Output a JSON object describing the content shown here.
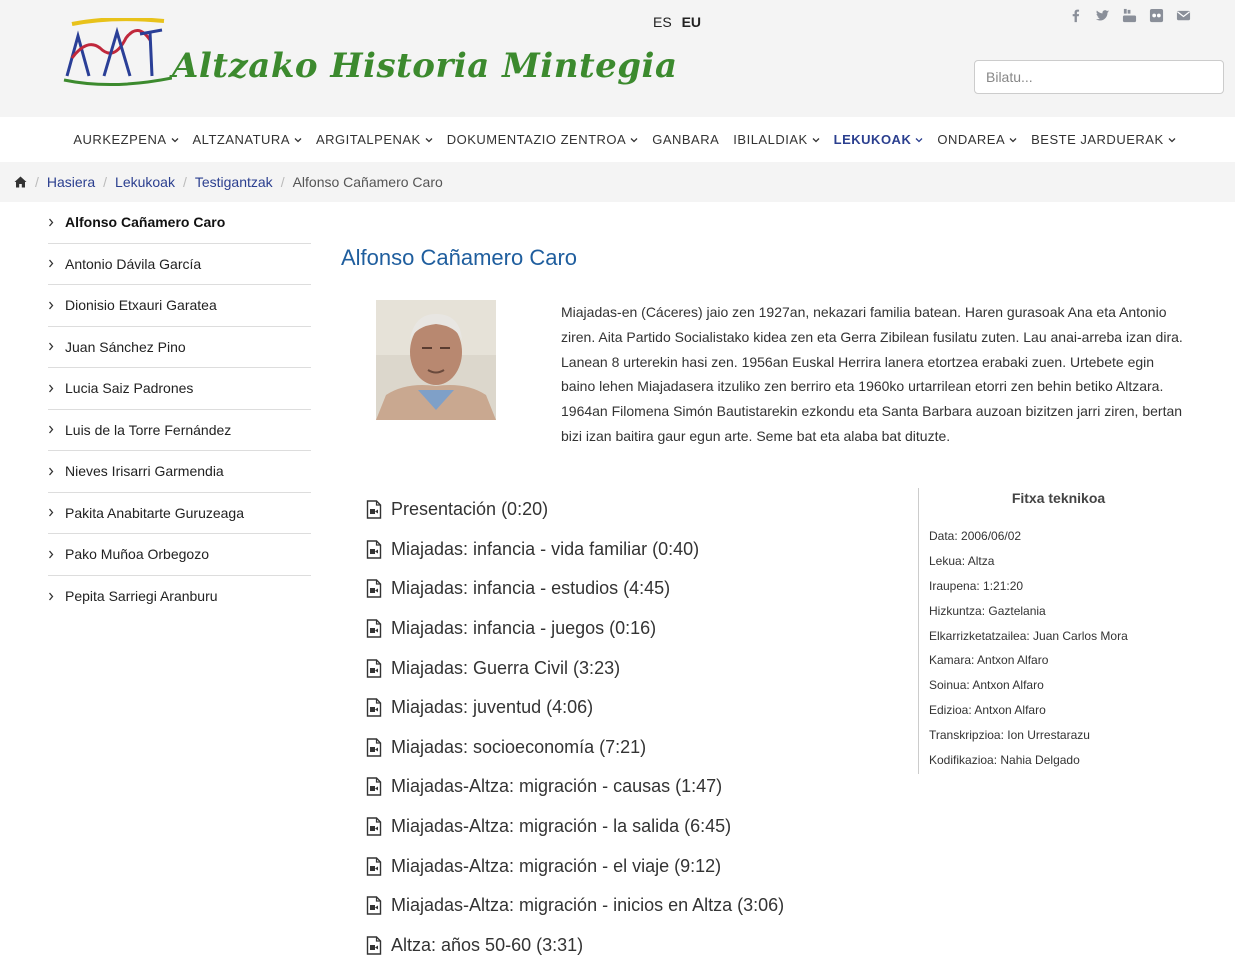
{
  "header": {
    "site_title": "Altzako Historia Mintegia",
    "languages": [
      "ES",
      "EU"
    ],
    "active_language": "EU",
    "social_icons": [
      "facebook-icon",
      "twitter-icon",
      "youtube-icon",
      "flickr-icon",
      "email-icon"
    ],
    "search_placeholder": "Bilatu..."
  },
  "nav": {
    "items": [
      {
        "label": "AURKEZPENA",
        "dropdown": true
      },
      {
        "label": "ALTZANATURA",
        "dropdown": true
      },
      {
        "label": "ARGITALPENAK",
        "dropdown": true
      },
      {
        "label": "DOKUMENTAZIO ZENTROA",
        "dropdown": true
      },
      {
        "label": "GANBARA",
        "dropdown": false
      },
      {
        "label": "IBILALDIAK",
        "dropdown": true
      },
      {
        "label": "LEKUKOAK",
        "dropdown": true,
        "active": true
      },
      {
        "label": "ONDAREA",
        "dropdown": true
      },
      {
        "label": "BESTE JARDUERAK",
        "dropdown": true
      }
    ]
  },
  "breadcrumb": {
    "items": [
      "Hasiera",
      "Lekukoak",
      "Testigantzak"
    ],
    "current": "Alfonso Cañamero Caro"
  },
  "sidebar": {
    "items": [
      "Alfonso Cañamero Caro",
      "Antonio Dávila García",
      "Dionisio Etxauri Garatea",
      "Juan Sánchez Pino",
      "Lucia Saiz Padrones",
      "Luis de la Torre Fernández",
      "Nieves Irisarri Garmendia",
      "Pakita Anabitarte Guruzeaga",
      "Pako Muñoa Orbegozo",
      "Pepita Sarriegi Aranburu"
    ],
    "active_index": 0
  },
  "main": {
    "title": "Alfonso Cañamero Caro",
    "bio": "Miajadas-en (Cáceres) jaio zen 1927an, nekazari familia batean. Haren gurasoak Ana eta Antonio ziren. Aita Partido Socialistako kidea zen eta Gerra Zibilean fusilatu zuten. Lau anai-arreba izan dira. Lanean 8 urterekin hasi zen. 1956an Euskal Herrira lanera etortzea erabaki zuen. Urtebete egin baino lehen Miajadasera itzuliko zen berriro eta 1960ko urtarrilean etorri zen behin betiko Altzara. 1964an Filomena Simón Bautistarekin ezkondu eta Santa Barbara auzoan bizitzen jarri ziren, bertan bizi izan baitira gaur egun arte. Seme bat eta alaba bat dituzte.",
    "videos": [
      "Presentación (0:20)",
      "Miajadas: infancia - vida familiar (0:40)",
      "Miajadas: infancia - estudios (4:45)",
      "Miajadas: infancia - juegos (0:16)",
      "Miajadas: Guerra Civil (3:23)",
      "Miajadas: juventud (4:06)",
      "Miajadas: socioeconomía (7:21)",
      "Miajadas-Altza: migración - causas (1:47)",
      "Miajadas-Altza: migración - la salida (6:45)",
      "Miajadas-Altza: migración - el viaje (9:12)",
      "Miajadas-Altza: migración - inicios en Altza (3:06)",
      "Altza: años 50-60 (3:31)"
    ]
  },
  "fitxa": {
    "title": "Fitxa teknikoa",
    "rows": [
      "Data: 2006/06/02",
      "Lekua: Altza",
      "Iraupena: 1:21:20",
      "Hizkuntza: Gaztelania",
      "Elkarrizketatzailea: Juan Carlos Mora",
      "Kamara: Antxon Alfaro",
      "Soinua: Antxon Alfaro",
      "Edizioa: Antxon Alfaro",
      "Transkripzioa: Ion Urrestarazu",
      "Kodifikazioa: Nahia Delgado"
    ]
  },
  "colors": {
    "link": "#2b3f8f",
    "title": "#1f5e9e",
    "logo_green": "#3c8a2e",
    "header_bg": "#f4f4f4"
  }
}
